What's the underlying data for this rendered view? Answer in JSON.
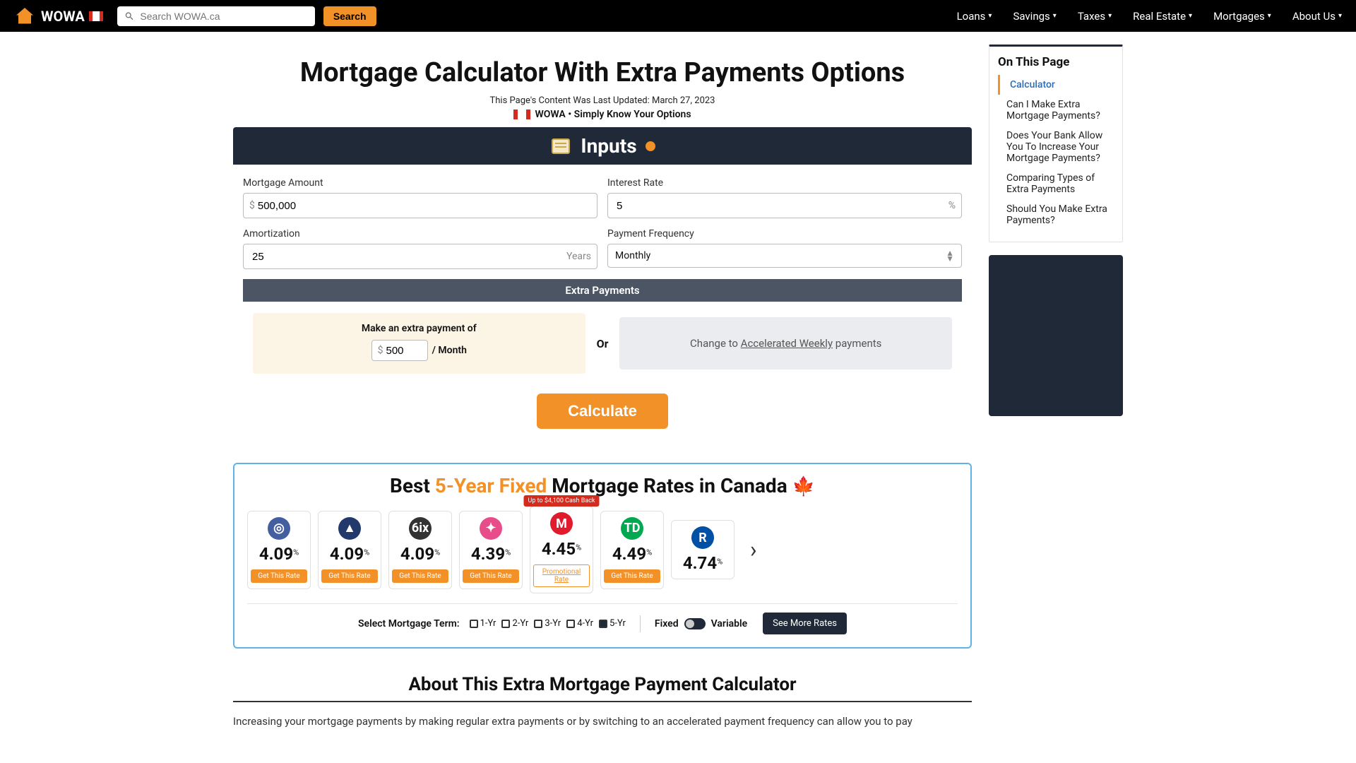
{
  "brand": "WOWA",
  "search": {
    "placeholder": "Search WOWA.ca",
    "button": "Search"
  },
  "nav": [
    "Loans",
    "Savings",
    "Taxes",
    "Real Estate",
    "Mortgages",
    "About Us"
  ],
  "page_title": "Mortgage Calculator With Extra Payments Options",
  "updated_prefix": "This Page's Content Was Last Updated: ",
  "updated_date": "March 27, 2023",
  "tagline": "WOWA • Simply Know Your Options",
  "inputs_header": "Inputs",
  "fields": {
    "mortgage_amount": {
      "label": "Mortgage Amount",
      "prefix": "$",
      "value": "500,000"
    },
    "interest_rate": {
      "label": "Interest Rate",
      "value": "5",
      "suffix": "%"
    },
    "amortization": {
      "label": "Amortization",
      "value": "25",
      "suffix": "Years"
    },
    "payment_frequency": {
      "label": "Payment Frequency",
      "value": "Monthly"
    }
  },
  "extra": {
    "header": "Extra Payments",
    "make_label": "Make an extra payment of",
    "prefix": "$",
    "value": "500",
    "per": "/ Month",
    "or": "Or",
    "change_to": "Change to",
    "accel": "Accelerated Weekly",
    "payments": "payments"
  },
  "calculate": "Calculate",
  "rates": {
    "title_prefix": "Best ",
    "title_hl": "5-Year Fixed",
    "title_suffix": " Mortgage Rates in Canada ",
    "cards": [
      {
        "logo_bg": "#445fa0",
        "logo_txt": "◎",
        "rate": "4.09",
        "cta": "Get This Rate"
      },
      {
        "logo_bg": "#213a6b",
        "logo_txt": "▲",
        "rate": "4.09",
        "cta": "Get This Rate"
      },
      {
        "logo_bg": "#333333",
        "logo_txt": "6ix",
        "rate": "4.09",
        "cta": "Get This Rate"
      },
      {
        "logo_bg": "#e84c8a",
        "logo_txt": "✦",
        "rate": "4.39",
        "cta": "Get This Rate"
      },
      {
        "logo_bg": "#e11b2d",
        "logo_txt": "M",
        "rate": "4.45",
        "cta": "Promotional Rate",
        "cashback": "Up to $4,100 Cash Back",
        "promo": true
      },
      {
        "logo_bg": "#00a94f",
        "logo_txt": "TD",
        "rate": "4.49",
        "cta": "Get This Rate"
      },
      {
        "logo_bg": "#0051a5",
        "logo_txt": "R",
        "rate": "4.74",
        "cta": ""
      }
    ],
    "term_label": "Select Mortgage Term:",
    "terms": [
      "1-Yr",
      "2-Yr",
      "3-Yr",
      "4-Yr",
      "5-Yr"
    ],
    "active_term": "5-Yr",
    "fixed": "Fixed",
    "variable": "Variable",
    "more": "See More Rates"
  },
  "about_title": "About This Extra Mortgage Payment Calculator",
  "about_text": "Increasing your mortgage payments by making regular extra payments or by switching to an accelerated payment frequency can allow you to pay",
  "toc": {
    "heading": "On This Page",
    "items": [
      "Calculator",
      "Can I Make Extra Mortgage Payments?",
      "Does Your Bank Allow You To Increase Your Mortgage Payments?",
      "Comparing Types of Extra Payments",
      "Should You Make Extra Payments?"
    ],
    "active": 0
  }
}
